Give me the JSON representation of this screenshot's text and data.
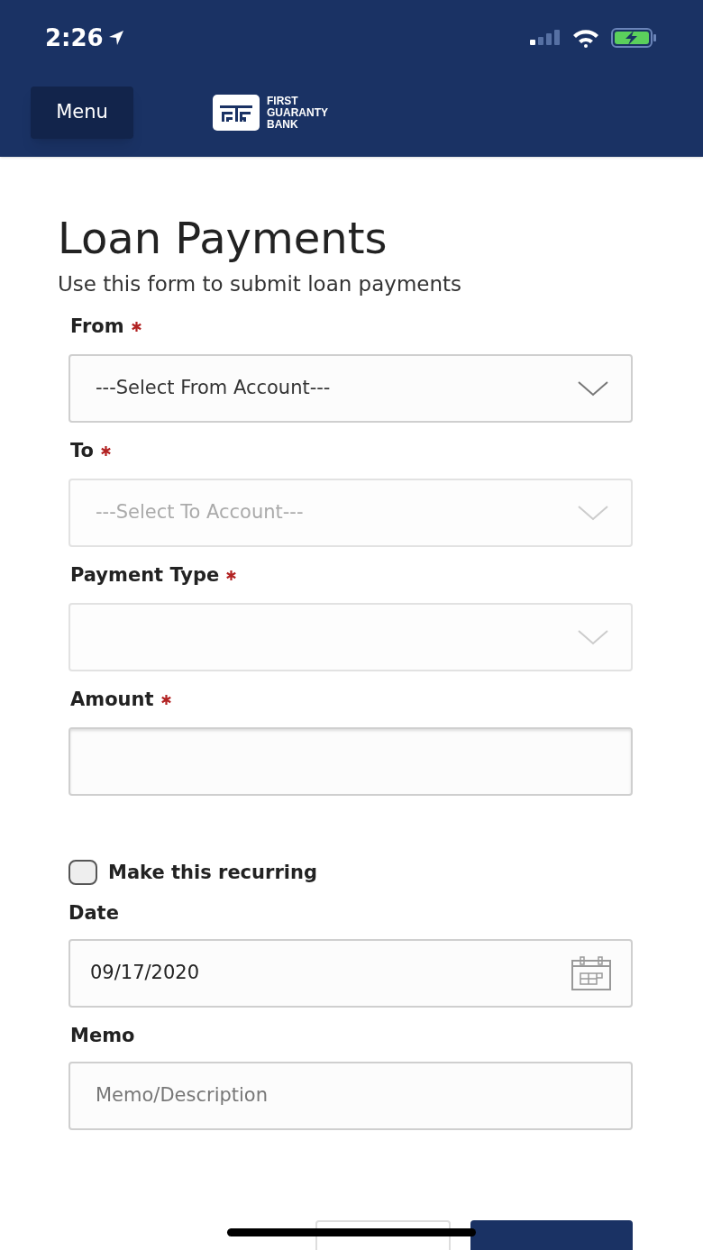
{
  "status_bar": {
    "time": "2:26"
  },
  "header": {
    "menu_button": "Menu",
    "logo_lines": [
      "FIRST",
      "GUARANTY",
      "BANK"
    ]
  },
  "page": {
    "title": "Loan Payments",
    "subtitle": "Use this form to submit loan payments"
  },
  "fields": [
    {
      "kind": "select",
      "label": "From",
      "required": true,
      "value": "---Select From Account---",
      "disabled": false
    },
    {
      "kind": "select",
      "label": "To",
      "required": true,
      "value": "---Select To Account---",
      "disabled": true
    },
    {
      "kind": "select",
      "label": "Payment Type",
      "required": true,
      "disabled": true
    },
    {
      "kind": "input",
      "label": "Amount",
      "required": true
    },
    {
      "kind": "checkbox",
      "label": "Make this recurring",
      "checked": false
    },
    {
      "kind": "date",
      "label": "Date",
      "value": "09/17/2020"
    },
    {
      "kind": "text",
      "label": "Memo",
      "placeholder": "Memo/Description"
    }
  ],
  "buttons": [
    {
      "kind": "secondary"
    },
    {
      "kind": "primary"
    }
  ]
}
